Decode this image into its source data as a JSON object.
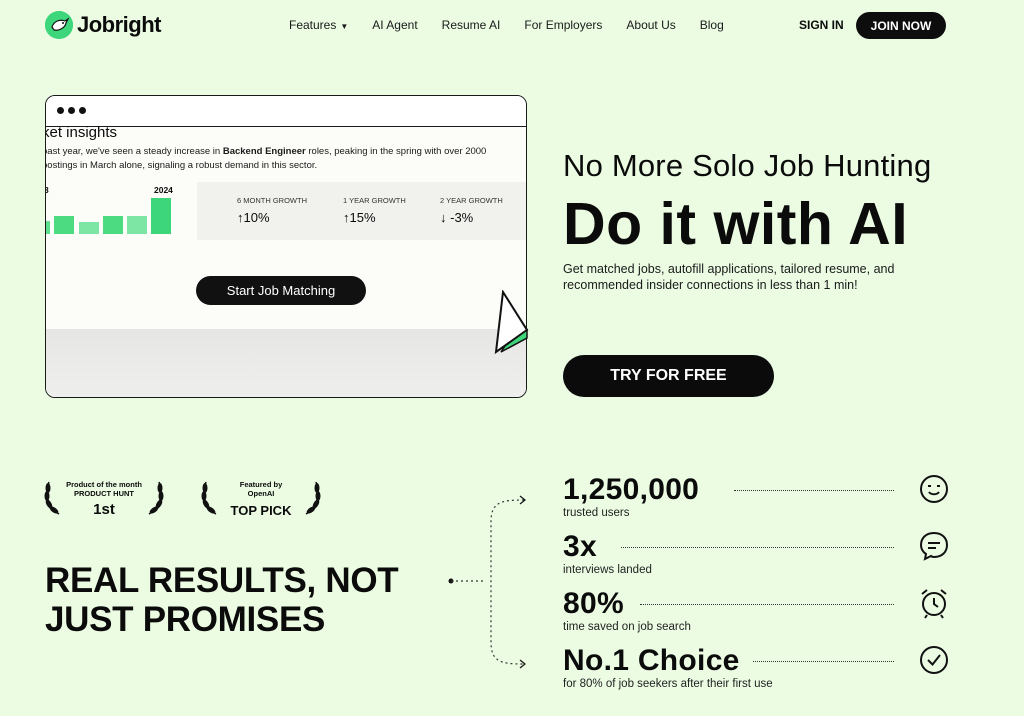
{
  "nav": {
    "logo_text": "Jobright",
    "links": [
      "Features",
      "AI Agent",
      "Resume AI",
      "For Employers",
      "About Us",
      "Blog"
    ],
    "sign_in": "SIGN IN",
    "join_now": "JOIN NOW"
  },
  "window": {
    "insights_title": "ket insights",
    "insights_text_pre": "past year, we've seen a steady increase in ",
    "insights_text_bold": "Backend Engineer",
    "insights_text_post": " roles, peaking in the spring with over 2000 postings in March alone, signaling a robust demand in this sector.",
    "insights_text_line2": "gs in March alone, signaling a robust demand in this sector.",
    "year_left": "3",
    "year_right": "2024",
    "growth": [
      {
        "label": "6 MONTH GROWTH",
        "value": "10%",
        "direction": "up"
      },
      {
        "label": "1 YEAR GROWTH",
        "value": "15%",
        "direction": "up"
      },
      {
        "label": "2 YEAR GROWTH",
        "value": "-3%",
        "direction": "down"
      }
    ],
    "start_button": "Start Job Matching"
  },
  "hero": {
    "subtitle": "No More Solo Job Hunting",
    "title": "Do it with AI",
    "description": "Get matched jobs, autofill applications, tailored resume, and recommended insider connections in less than 1 min!",
    "cta": "TRY FOR FREE"
  },
  "badges": [
    {
      "small": "Product of the month",
      "small2": "PRODUCT HUNT",
      "big": "1st"
    },
    {
      "small": "Featured by",
      "small2": "OpenAI",
      "big": "TOP PICK"
    }
  ],
  "results_heading_line1": "REAL RESULTS, NOT",
  "results_heading_line2": "JUST PROMISES",
  "stats": [
    {
      "number": "1,250,000",
      "label": "trusted users",
      "icon": "smile-icon"
    },
    {
      "number": "3x",
      "label": "interviews landed",
      "icon": "chat-icon"
    },
    {
      "number": "80%",
      "label": "time saved on job search",
      "icon": "alarm-clock-icon"
    },
    {
      "number": "No.1 Choice",
      "label": "for 80% of job seekers after their first use",
      "icon": "check-circle-icon"
    }
  ],
  "colors": {
    "background": "#ebfce3",
    "accent_green": "#3ed67a",
    "dark": "#0b0b0b"
  }
}
